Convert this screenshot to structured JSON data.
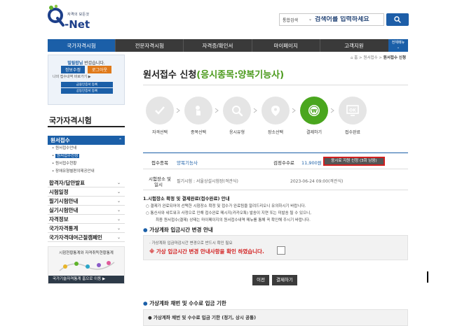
{
  "header": {
    "logo_tag": "자격의 모든것",
    "logo_text": "-Net",
    "search_category": "통합검색",
    "search_placeholder": "검색어를 입력하세요"
  },
  "nav": {
    "items": [
      "국가자격시험",
      "전문자격시험",
      "자격증/확인서",
      "마이페이지",
      "고객지원"
    ],
    "all_menu": "전체메뉴"
  },
  "sidebar": {
    "welcome_name": "빌릴랍님",
    "welcome_suffix": " 반갑습니다.",
    "info_btn": "정보수정",
    "logout_btn": "로그아웃",
    "recent_link": "나의 접수내역 바로가기 ▶",
    "small_btn1": "금융인증서 등록",
    "small_btn2": "공동인증서 등록",
    "title": "국가자격시험",
    "section": "원서접수",
    "sub_items": [
      "원서접수안내",
      "원서접수신청",
      "원서접수현황",
      "장애유형별편의제공안내"
    ],
    "main_items": [
      "합격자/답안발표",
      "시험일정",
      "필기시험안내",
      "실기시험안내",
      "자격정보",
      "국가자격통계",
      "국가자격대여근절캠페인"
    ],
    "banner_title": "시험현황통계와 자격취득현황통계",
    "banner_btn": "국가기술자격통계 홈으로 이동 ▶"
  },
  "breadcrumb": {
    "home": "홈",
    "sep": " > ",
    "mid": "원서접수",
    "current": "원서접수 신청"
  },
  "page": {
    "title_main": "원서접수 신청",
    "title_accent": "(응시종목:양복기능사)"
  },
  "steps": [
    {
      "label": "자격선택",
      "icon": "check-icon"
    },
    {
      "label": "종목선택",
      "icon": "pointer-icon"
    },
    {
      "label": "응시유형",
      "icon": "magnifier-icon"
    },
    {
      "label": "장소선택",
      "icon": "location-pin-icon"
    },
    {
      "label": "결제하기",
      "icon": "coin-icon"
    },
    {
      "label": "접수완료",
      "icon": "ok-monitor-icon"
    }
  ],
  "info": {
    "item_label": "접수종목",
    "item_value": "양복기능사",
    "fee_label": "검정수수료",
    "fee_value": "11,900원",
    "fee_button": "응시료 지원 신청 (3회 남음)",
    "place_label1": "시험장소 및",
    "place_label2": "일시",
    "place_value": "필기시험 : 서울상설시험장(격관식)",
    "date_value": "2023-06-24 09:00(격관식)"
  },
  "notice": {
    "heading": "1.시험장소 확정 및 결제완료(접수완료) 안내",
    "lines": [
      "○ 결제가 완료되어야 선택한 시험장소 확정 및 접수가 완료됨을 알려드리오니 유의하시기 바랍니다.",
      "○ 통신사와 네트워크 사정으로 인해 접수완료 메시지(카카오톡) 발송이 지연 또는 미발송 될 수 있으니,",
      "최종 원서접수(결제) 상태는 마이페이지의 원서접수내역 메뉴를 통해 꼭 확인해 주시기 바랍니다."
    ]
  },
  "virtual": {
    "title": "가상계좌 입금시간 변경 안내",
    "line1": "· 가상계좌 입금마감시간 변경으로 반드시 확인 필요",
    "line2": "※ 가상 입금시간 변경 안내사항을 확인 하였습니다."
  },
  "actions": {
    "prev": "이전",
    "pay": "결제하기"
  },
  "section2": {
    "title": "가상계좌 채번 및 수수료 입금 기한",
    "line": "● 가상계좌 채번 및 수수료 입금 기한 (정기, 상시 공통)"
  },
  "colors": {
    "primary": "#1b5fa8",
    "accent_green": "#4aa61e",
    "warning_red": "#d21f1f"
  }
}
